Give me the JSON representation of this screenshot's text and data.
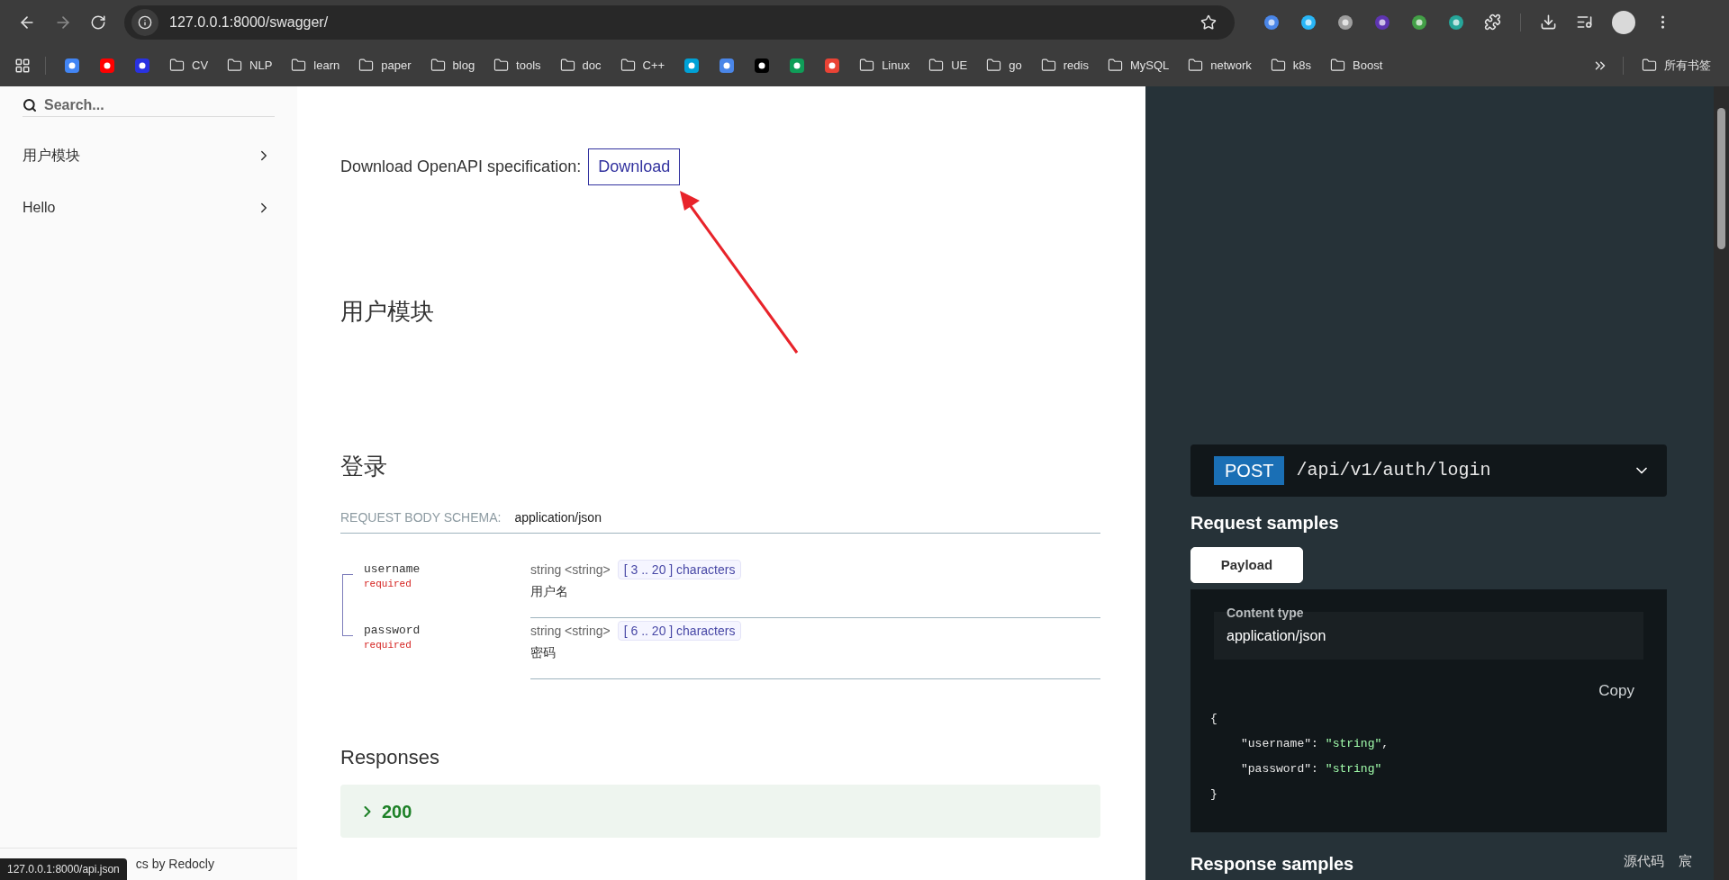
{
  "browser": {
    "url": "127.0.0.1:8000/swagger/",
    "bookmarks": [
      {
        "kind": "site",
        "color": "#4285f4"
      },
      {
        "kind": "site",
        "color": "#ff0000"
      },
      {
        "kind": "site",
        "color": "#2932e1"
      },
      {
        "kind": "folder",
        "label": "CV"
      },
      {
        "kind": "folder",
        "label": "NLP"
      },
      {
        "kind": "folder",
        "label": "learn"
      },
      {
        "kind": "folder",
        "label": "paper"
      },
      {
        "kind": "folder",
        "label": "blog"
      },
      {
        "kind": "folder",
        "label": "tools"
      },
      {
        "kind": "folder",
        "label": "doc"
      },
      {
        "kind": "folder",
        "label": "C++"
      },
      {
        "kind": "site",
        "color": "#00a1d6"
      },
      {
        "kind": "site",
        "color": "#4a86e8"
      },
      {
        "kind": "site",
        "color": "#000000"
      },
      {
        "kind": "site",
        "color": "#0f9d58"
      },
      {
        "kind": "site",
        "color": "#ea4335"
      },
      {
        "kind": "folder",
        "label": "Linux"
      },
      {
        "kind": "folder",
        "label": "UE"
      },
      {
        "kind": "folder",
        "label": "go"
      },
      {
        "kind": "folder",
        "label": "redis"
      },
      {
        "kind": "folder",
        "label": "MySQL"
      },
      {
        "kind": "folder",
        "label": "network"
      },
      {
        "kind": "folder",
        "label": "k8s"
      },
      {
        "kind": "folder",
        "label": "Boost"
      }
    ],
    "all_bookmarks": "所有书签"
  },
  "sidebar": {
    "search_placeholder": "Search...",
    "items": [
      {
        "label": "用户模块"
      },
      {
        "label": "Hello"
      }
    ],
    "footer": "cs by Redocly"
  },
  "main": {
    "download_label": "Download OpenAPI specification:",
    "download_button": "Download",
    "section_title": "用户模块",
    "operation_title": "登录",
    "body_schema_label": "REQUEST BODY SCHEMA:",
    "body_schema_type": "application/json",
    "fields": [
      {
        "name": "username",
        "required": "required",
        "type": "string <string>",
        "constraint": "[ 3 .. 20 ] characters",
        "description": "用户名"
      },
      {
        "name": "password",
        "required": "required",
        "type": "string <string>",
        "constraint": "[ 6 .. 20 ] characters",
        "description": "密码"
      }
    ],
    "responses_title": "Responses",
    "responses": [
      {
        "code": "200"
      }
    ]
  },
  "panel": {
    "method": "POST",
    "path": "/api/v1/auth/login",
    "request_samples_title": "Request samples",
    "tabs": [
      {
        "label": "Payload",
        "selected": true
      }
    ],
    "content_type_label": "Content type",
    "content_type": "application/json",
    "copy": "Copy",
    "code_lines": [
      {
        "kind": "brace",
        "text": "{"
      },
      {
        "kind": "pair",
        "key": "\"username\"",
        "colon": ":",
        "value": "\"string\"",
        "comma": ","
      },
      {
        "kind": "pair",
        "key": "\"password\"",
        "colon": ":",
        "value": "\"string\""
      },
      {
        "kind": "brace",
        "text": "}"
      }
    ],
    "response_samples_title": "Response samples"
  },
  "status_tooltip": "127.0.0.1:8000/api.json",
  "overlay_texts": [
    "源代码",
    "宸"
  ]
}
